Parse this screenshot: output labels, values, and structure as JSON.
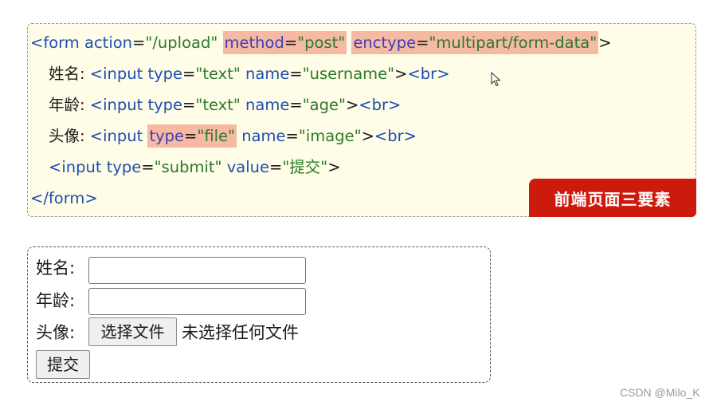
{
  "code_panel": {
    "line1": {
      "open": "<form",
      "attr_action": "action",
      "eq1": "=",
      "val_action": "\"/upload\"",
      "attr_method": "method",
      "eq2": "=",
      "val_method": "\"post\"",
      "attr_enctype": "enctype",
      "eq3": "=",
      "val_enctype": "\"multipart/form-data\"",
      "close": ">"
    },
    "line2": {
      "label": "姓名: ",
      "open": "<input",
      "attr_type": "type",
      "eq1": "=",
      "val_type": "\"text\"",
      "attr_name": "name",
      "eq2": "=",
      "val_name": "\"username\"",
      "close": ">",
      "br": "<br>"
    },
    "line3": {
      "label": "年龄: ",
      "open": "<input",
      "attr_type": "type",
      "eq1": "=",
      "val_type": "\"text\"",
      "attr_name": "name",
      "eq2": "=",
      "val_name": "\"age\"",
      "close": ">",
      "br": "<br>"
    },
    "line4": {
      "label": "头像: ",
      "open": "<input",
      "attr_type": "type",
      "eq1": "=",
      "val_type": "\"file\"",
      "attr_name": "name",
      "eq2": "=",
      "val_name": "\"image\"",
      "close": ">",
      "br": "<br>"
    },
    "line5": {
      "open": "<input",
      "attr_type": "type",
      "eq1": "=",
      "val_type": "\"submit\"",
      "attr_value": "value",
      "eq2": "=",
      "val_value": "\"提交\"",
      "close": ">"
    },
    "line6": {
      "text": "</form>"
    },
    "badge": "前端页面三要素",
    "colors": {
      "panel_bg": "#fffde7",
      "highlight": "#f6b9a3",
      "tag": "#1b4fb1",
      "value": "#2a7a2a",
      "badge_bg": "#cc1a0c"
    }
  },
  "rendered_form": {
    "username_label": "姓名:",
    "age_label": "年龄:",
    "avatar_label": "头像:",
    "file_button": "选择文件",
    "file_status": "未选择任何文件",
    "submit": "提交"
  },
  "watermark": "CSDN @Milo_K"
}
